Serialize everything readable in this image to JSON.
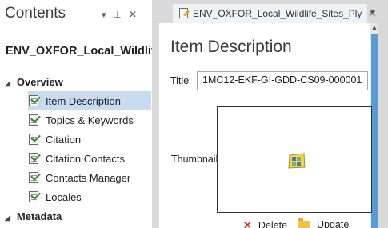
{
  "contents_pane": {
    "title": "Contents",
    "controls": {
      "dropdown": "▾",
      "pin": "⊥",
      "close": "✕"
    },
    "item_name": "ENV_OXFOR_Local_Wildlif...",
    "groups": [
      {
        "label": "Overview",
        "expanded": true,
        "items": [
          {
            "label": "Item Description",
            "selected": true
          },
          {
            "label": "Topics & Keywords",
            "selected": false
          },
          {
            "label": "Citation",
            "selected": false
          },
          {
            "label": "Citation Contacts",
            "selected": false
          },
          {
            "label": "Contacts Manager",
            "selected": false
          },
          {
            "label": "Locales",
            "selected": false
          }
        ]
      },
      {
        "label": "Metadata",
        "expanded": true
      }
    ]
  },
  "document_tab": {
    "label": "ENV_OXFOR_Local_Wildlife_Sites_Ply",
    "close": "✕",
    "menu": "▾"
  },
  "item_description": {
    "heading": "Item Description",
    "title_label": "Title",
    "title_value": "1MC12-EKF-GI-GDD-CS09-000001",
    "thumbnail_label": "Thumbnail",
    "delete_label": "Delete",
    "update_label": "Update"
  },
  "colors": {
    "selection": "#c8dcf0",
    "scrollbar_thumb": "#5b9bd5",
    "delete_icon": "#d33a2c",
    "folder_icon": "#f1c24b"
  }
}
